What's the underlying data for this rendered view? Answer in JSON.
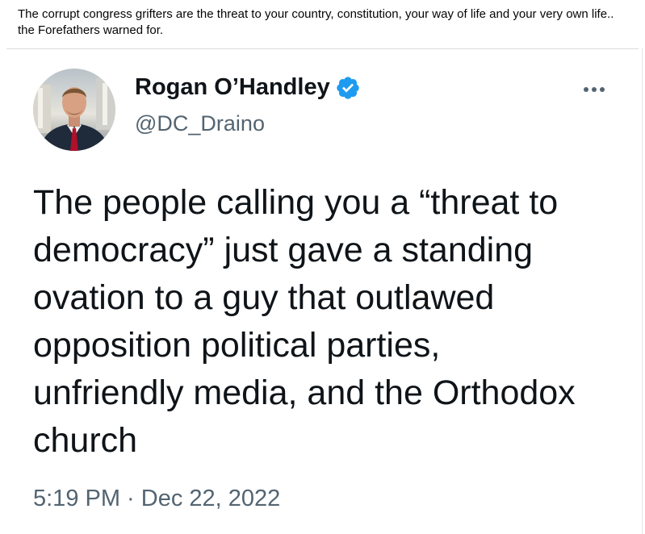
{
  "post": {
    "caption": "The corrupt congress grifters are the threat to your country, constitution, your way of life and your very own life.. the Forefathers warned for."
  },
  "tweet": {
    "author_name": "Rogan O’Handley",
    "handle": "@DC_Draino",
    "verified": true,
    "text": "The people calling you a “threat to democracy” just gave a standing ovation to a guy that outlawed opposition political parties, unfriendly media, and the Orthodox church",
    "timestamp": "5:19 PM · Dec 22, 2022",
    "more_icon": "more-horizontal-icon",
    "verified_icon": "verified-badge-icon",
    "verified_color": "#1d9bf0"
  }
}
